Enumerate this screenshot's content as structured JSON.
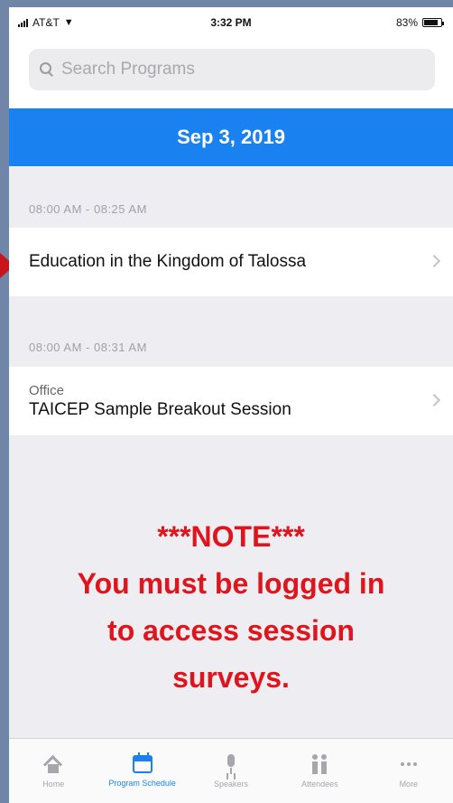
{
  "status_bar": {
    "carrier": "AT&T",
    "time": "3:32 PM",
    "battery": "83%"
  },
  "search": {
    "placeholder": "Search Programs",
    "value": ""
  },
  "date_header": "Sep 3, 2019",
  "sessions": [
    {
      "time_range": "08:00 AM - 08:25 AM",
      "location": "",
      "title": "Education in the Kingdom of Talossa"
    },
    {
      "time_range": "08:00 AM - 08:31 AM",
      "location": "Office",
      "title": "TAICEP Sample Breakout Session"
    }
  ],
  "note": {
    "line1": "***NOTE***",
    "line2": "You must be logged in",
    "line3": "to access  session",
    "line4": "surveys."
  },
  "tabs": [
    {
      "label": "Home",
      "icon": "home-icon",
      "active": false
    },
    {
      "label": "Program Schedule",
      "icon": "calendar-icon",
      "active": true
    },
    {
      "label": "Speakers",
      "icon": "mic-icon",
      "active": false
    },
    {
      "label": "Attendees",
      "icon": "people-icon",
      "active": false
    },
    {
      "label": "More",
      "icon": "more-icon",
      "active": false
    }
  ],
  "colors": {
    "accent": "#1a82f0",
    "note_red": "#e0141c",
    "marker_red": "#c8141a"
  }
}
